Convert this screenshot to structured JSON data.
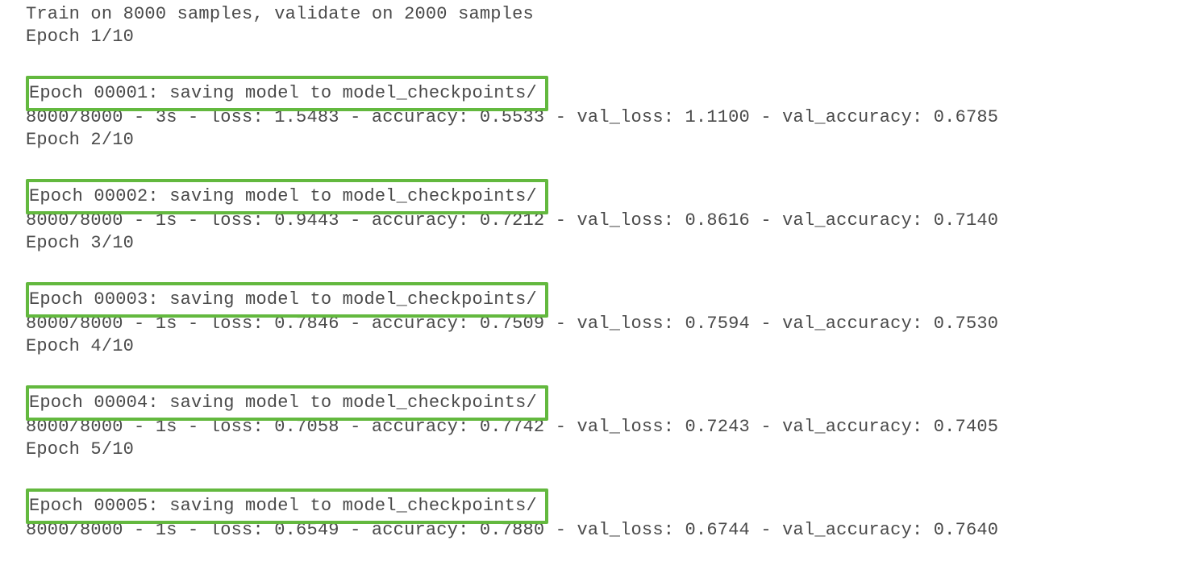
{
  "header": {
    "line1": "Train on 8000 samples, validate on 2000 samples",
    "line2": "Epoch 1/10"
  },
  "blocks": [
    {
      "saving": "Epoch 00001: saving model to model_checkpoints/",
      "stats": "8000/8000 - 3s - loss: 1.5483 - accuracy: 0.5533 - val_loss: 1.1100 - val_accuracy: 0.6785",
      "next": "Epoch 2/10"
    },
    {
      "saving": "Epoch 00002: saving model to model_checkpoints/",
      "stats": "8000/8000 - 1s - loss: 0.9443 - accuracy: 0.7212 - val_loss: 0.8616 - val_accuracy: 0.7140",
      "next": "Epoch 3/10"
    },
    {
      "saving": "Epoch 00003: saving model to model_checkpoints/",
      "stats": "8000/8000 - 1s - loss: 0.7846 - accuracy: 0.7509 - val_loss: 0.7594 - val_accuracy: 0.7530",
      "next": "Epoch 4/10"
    },
    {
      "saving": "Epoch 00004: saving model to model_checkpoints/",
      "stats": "8000/8000 - 1s - loss: 0.7058 - accuracy: 0.7742 - val_loss: 0.7243 - val_accuracy: 0.7405",
      "next": "Epoch 5/10"
    },
    {
      "saving": "Epoch 00005: saving model to model_checkpoints/",
      "stats": "8000/8000 - 1s - loss: 0.6549 - accuracy: 0.7880 - val_loss: 0.6744 - val_accuracy: 0.7640",
      "next": ""
    }
  ]
}
